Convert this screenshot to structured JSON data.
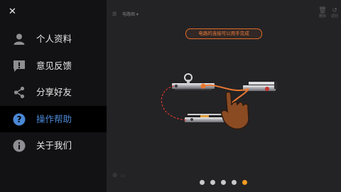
{
  "toolbar": {
    "project_label": "电路图 ▾",
    "buttons": [
      "删除",
      "返回"
    ]
  },
  "hint": "电路的连接可以用手完成",
  "coordinate_label": "0/0",
  "page_dots": {
    "count": 5,
    "active_index": 4,
    "active_color": "#f39a22"
  },
  "drawer": {
    "close_icon": "close-icon",
    "items": [
      {
        "label": "个人资料",
        "icon": "user-icon",
        "active": false
      },
      {
        "label": "意见反馈",
        "icon": "feedback-icon",
        "active": false
      },
      {
        "label": "分享好友",
        "icon": "share-icon",
        "active": false
      },
      {
        "label": "操作帮助",
        "icon": "help-icon",
        "active": true
      },
      {
        "label": "关于我们",
        "icon": "info-icon",
        "active": false
      }
    ]
  },
  "colors": {
    "accent_blue": "#4a88d6",
    "hint_orange": "#e06a2b"
  }
}
